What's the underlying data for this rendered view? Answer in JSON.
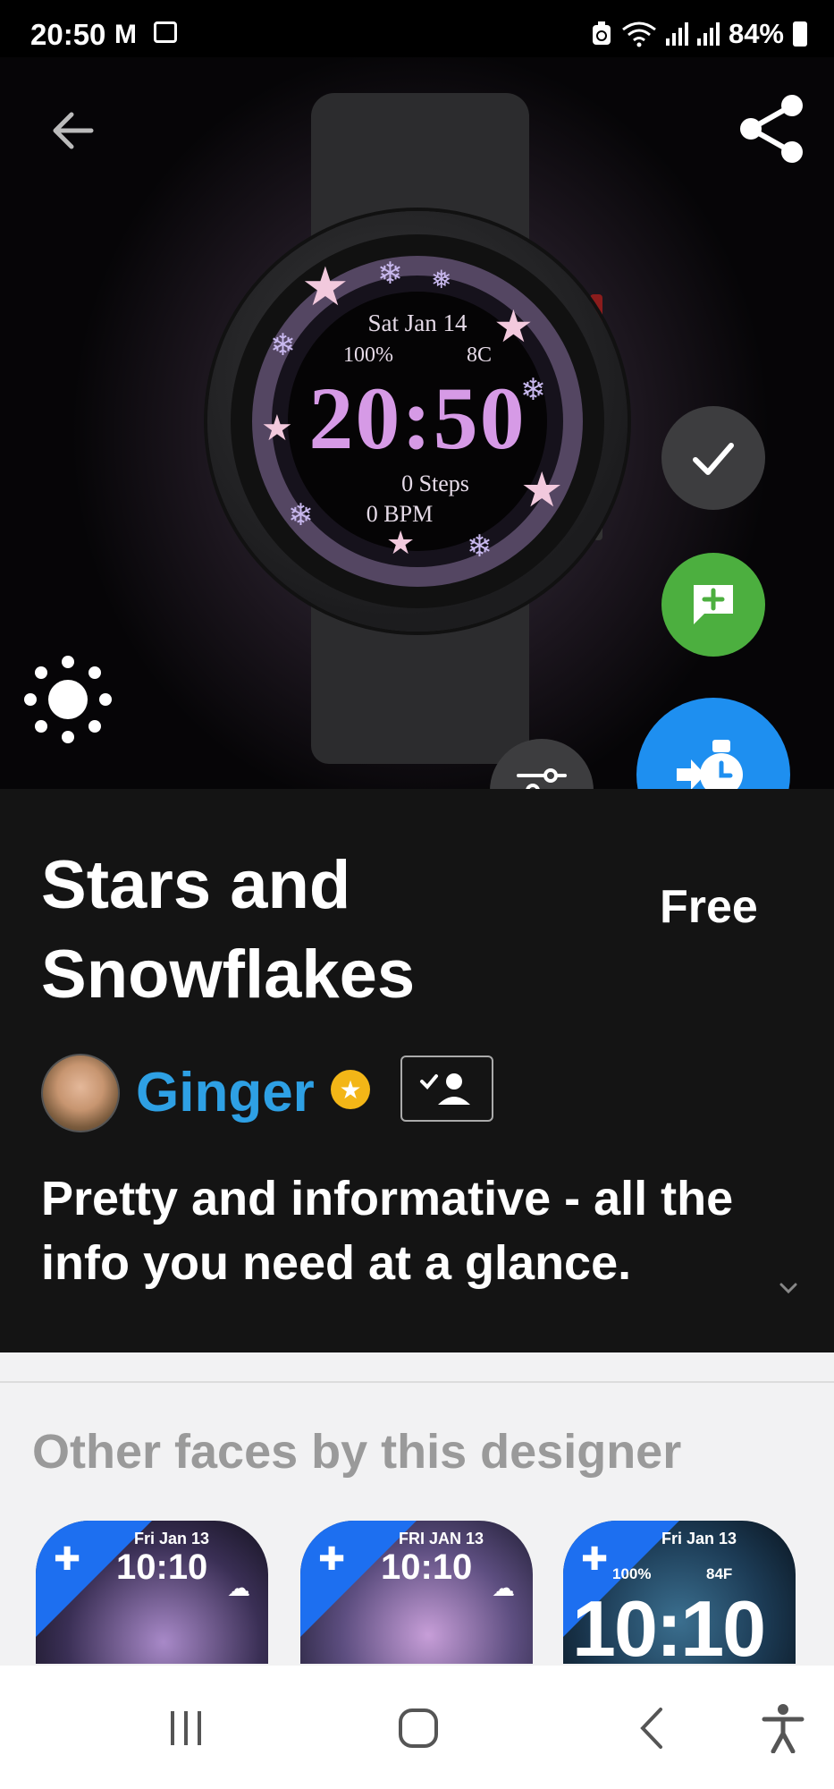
{
  "status_bar": {
    "time": "20:50",
    "notification_icons": [
      "gmail-icon",
      "screenshot-icon"
    ],
    "battery": "84%",
    "system_icons": [
      "battery-saver-icon",
      "wifi-icon",
      "signal-icon",
      "signal-icon",
      "battery-icon"
    ]
  },
  "hero": {
    "watch_face": {
      "date": "Sat Jan 14",
      "battery": "100%",
      "temp": "8C",
      "time": "20:50",
      "steps": "0 Steps",
      "bpm": "0 BPM"
    },
    "icons": {
      "back": "arrow-left-icon",
      "share": "share-icon",
      "brightness": "sun-icon",
      "check": "check-icon",
      "comment": "comment-add-icon",
      "customize": "sliders-icon",
      "install": "watch-install-icon"
    },
    "colors": {
      "install_button": "#1e8ff0",
      "comment_button": "#4caf3f",
      "dark_button": "#3d3d3f"
    }
  },
  "info": {
    "title": "Stars and Snowflakes",
    "price": "Free",
    "designer": {
      "name": "Ginger",
      "name_color": "#2ea0e4",
      "badge": "★"
    },
    "description": "Pretty and informative - all the info you need at a glance."
  },
  "other_faces": {
    "heading": "Other faces by this designer",
    "thumbnails": [
      {
        "date": "Fri Jan 13",
        "time": "10:10"
      },
      {
        "date": "FRI JAN 13",
        "time": "10:10"
      },
      {
        "date": "Fri Jan 13",
        "battery": "100%",
        "temp": "84F",
        "time": "10:10"
      }
    ]
  },
  "nav_bar": {
    "icons": [
      "recents-icon",
      "home-icon",
      "back-icon",
      "accessibility-icon"
    ]
  }
}
